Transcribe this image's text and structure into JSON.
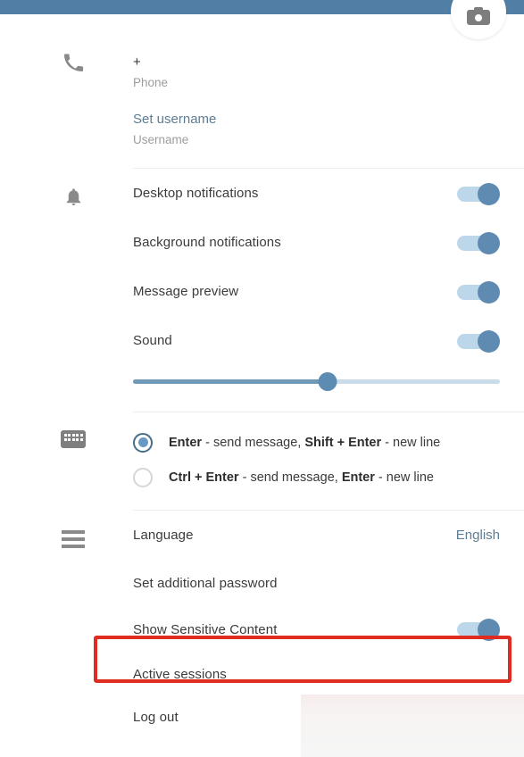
{
  "theme": {
    "header_blue": "#507ea4",
    "accent_blue": "#5f8bb2",
    "track_blue": "#bcd7ea",
    "link_slate": "#5c7d93",
    "highlight_red": "#e02b20",
    "text_dark": "#3b3b3b",
    "text_muted": "#9a9a9a"
  },
  "header": {
    "avatar_button": {
      "icon": "camera-icon",
      "label": "Change profile photo"
    }
  },
  "identity": {
    "icon": "phone-icon",
    "entries": [
      {
        "value": "+",
        "caption": "Phone",
        "is_link": false
      },
      {
        "value": "Set username",
        "caption": "Username",
        "is_link": true
      }
    ]
  },
  "notifications": {
    "icon": "bell-icon",
    "rows": [
      {
        "label": "Desktop notifications",
        "toggle": "on"
      },
      {
        "label": "Background notifications",
        "toggle": "on"
      },
      {
        "label": "Message preview",
        "toggle": "on"
      },
      {
        "label": "Sound",
        "toggle": "on"
      }
    ],
    "volume_slider": {
      "name": "notification-volume-slider",
      "value_percent": 53,
      "min": 0,
      "max": 100
    }
  },
  "send_keys": {
    "icon": "keyboard-icon",
    "options": [
      {
        "selected": true,
        "parts": [
          {
            "text": "Enter",
            "bold": true
          },
          {
            "text": " - send message, ",
            "bold": false
          },
          {
            "text": "Shift + Enter",
            "bold": true
          },
          {
            "text": " - new line",
            "bold": false
          }
        ]
      },
      {
        "selected": false,
        "parts": [
          {
            "text": "Ctrl + Enter",
            "bold": true
          },
          {
            "text": " - send message, ",
            "bold": false
          },
          {
            "text": "Enter",
            "bold": true
          },
          {
            "text": " - new line",
            "bold": false
          }
        ]
      }
    ]
  },
  "general": {
    "icon": "hamburger-icon",
    "rows": [
      {
        "label": "Language",
        "value": "English",
        "control": "value-link"
      },
      {
        "label": "Set additional password",
        "control": "none"
      },
      {
        "label": "Show Sensitive Content",
        "control": "toggle",
        "toggle": "on",
        "highlighted": true
      },
      {
        "label": "Active sessions",
        "control": "none"
      },
      {
        "label": "Log out",
        "control": "none"
      }
    ]
  },
  "annotation": {
    "name": "red-highlight-rectangle",
    "targets": "Show Sensitive Content",
    "color": "#e02b20"
  }
}
